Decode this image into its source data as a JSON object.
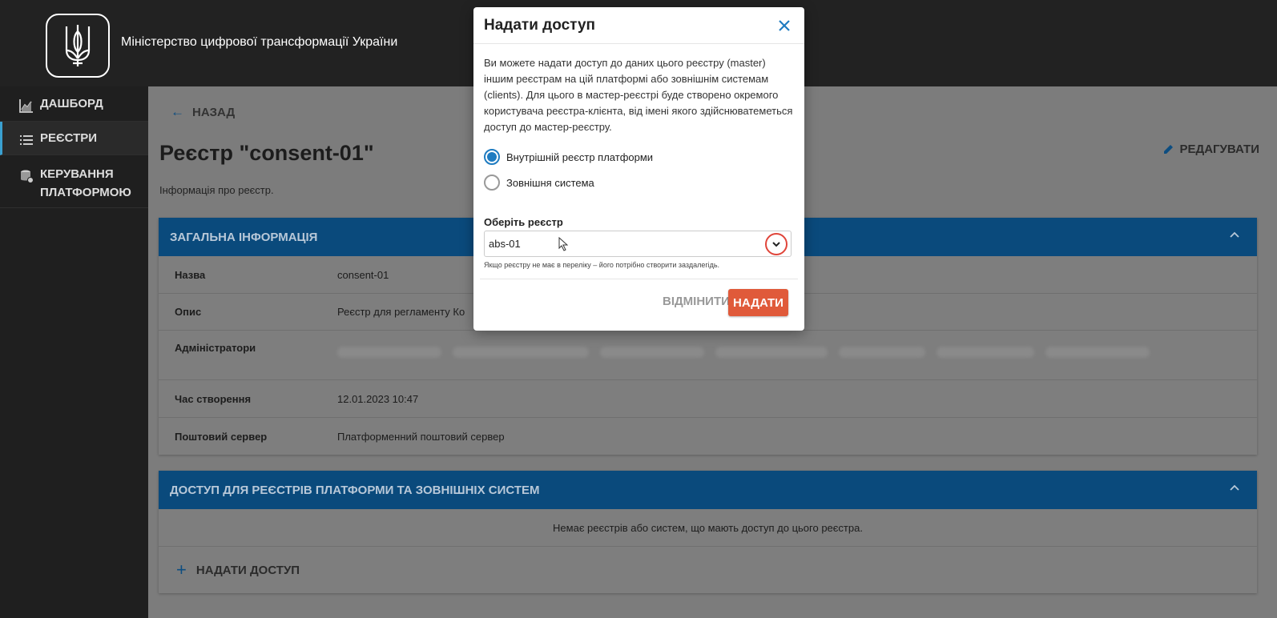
{
  "header": {
    "ministry_title": "Міністерство цифрової трансформації України"
  },
  "sidebar": {
    "items": [
      {
        "label": "ДАШБОРД",
        "icon": "chart-icon",
        "active": false
      },
      {
        "label": "РЕЄСТРИ",
        "icon": "list-icon",
        "active": true
      },
      {
        "label": "КЕРУВАННЯ ПЛАТФОРМОЮ",
        "icon": "database-gear-icon",
        "active": false
      }
    ]
  },
  "main": {
    "back_label": "НАЗАД",
    "title": "Реєстр \"consent-01\"",
    "subtitle": "Інформація про реєстр.",
    "edit_label": "РЕДАГУВАТИ",
    "general_info": {
      "header": "ЗАГАЛЬНА ІНФОРМАЦІЯ",
      "rows": [
        {
          "label": "Назва",
          "value": "consent-01"
        },
        {
          "label": "Опис",
          "value": "Реєстр для регламенту Ко"
        },
        {
          "label": "Адміністратори",
          "value": ""
        },
        {
          "label": "Час створення",
          "value": "12.01.2023 10:47"
        },
        {
          "label": "Поштовий сервер",
          "value": "Платформенний поштовий сервер"
        }
      ]
    },
    "access": {
      "header": "ДОСТУП ДЛЯ РЕЄСТРІВ ПЛАТФОРМИ ТА ЗОВНІШНІХ СИСТЕМ",
      "empty_message": "Немає реєстрів або систем, що мають доступ до цього реєстра.",
      "grant_label": "НАДАТИ ДОСТУП"
    }
  },
  "modal": {
    "title": "Надати доступ",
    "description": "Ви можете надати доступ до даних цього реєстру (master) іншим реєстрам на цій платформі або зовнішнім системам (clients). Для цього в мастер-реєстрі буде створено окремого користувача реєстра-клієнта, від імені якого здійснюватеметься доступ до мастер-реєстру.",
    "radio_options": [
      {
        "label": "Внутрішній реєстр платформи",
        "checked": true
      },
      {
        "label": "Зовнішня система",
        "checked": false
      }
    ],
    "select_label": "Оберіть реєстр",
    "select_value": "abs-01",
    "hint": "Якщо реєстру не має в переліку – його потрібно створити заздалегідь.",
    "cancel_label": "ВІДМІНИТИ",
    "submit_label": "НАДАТИ"
  },
  "colors": {
    "accent_blue": "#1f7cc1",
    "header_blue": "#0a4a7c",
    "submit_orange": "#e05a3a",
    "highlight_red": "#e0453a"
  }
}
